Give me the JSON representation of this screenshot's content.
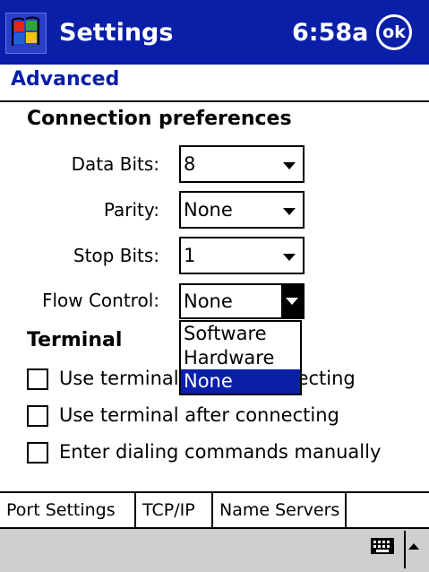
{
  "title_bar": {
    "app_title": "Settings",
    "clock": "6:58a",
    "ok_label": "ok"
  },
  "page": {
    "heading": "Advanced"
  },
  "connection": {
    "section_title": "Connection preferences",
    "data_bits": {
      "label": "Data Bits:",
      "value": "8"
    },
    "parity": {
      "label": "Parity:",
      "value": "None"
    },
    "stop_bits": {
      "label": "Stop Bits:",
      "value": "1"
    },
    "flow_control": {
      "label": "Flow Control:",
      "value": "None",
      "options": [
        "Software",
        "Hardware",
        "None"
      ],
      "selected_index": 2
    }
  },
  "terminal": {
    "section_title": "Terminal",
    "checkboxes": [
      {
        "label": "Use terminal before connecting",
        "checked": false
      },
      {
        "label": "Use terminal after connecting",
        "checked": false
      },
      {
        "label": "Enter dialing commands manually",
        "checked": false
      }
    ]
  },
  "tabs": [
    "Port Settings",
    "TCP/IP",
    "Name Servers"
  ],
  "colors": {
    "title_bar": "#0a1fa8",
    "heading": "#0a1fa8",
    "selection": "#0a1fa8",
    "bottom_bar": "#cfcfcf"
  },
  "icons": {
    "start": "windows-flag-icon",
    "keyboard": "keyboard-icon",
    "sip": "up-arrow-icon"
  }
}
